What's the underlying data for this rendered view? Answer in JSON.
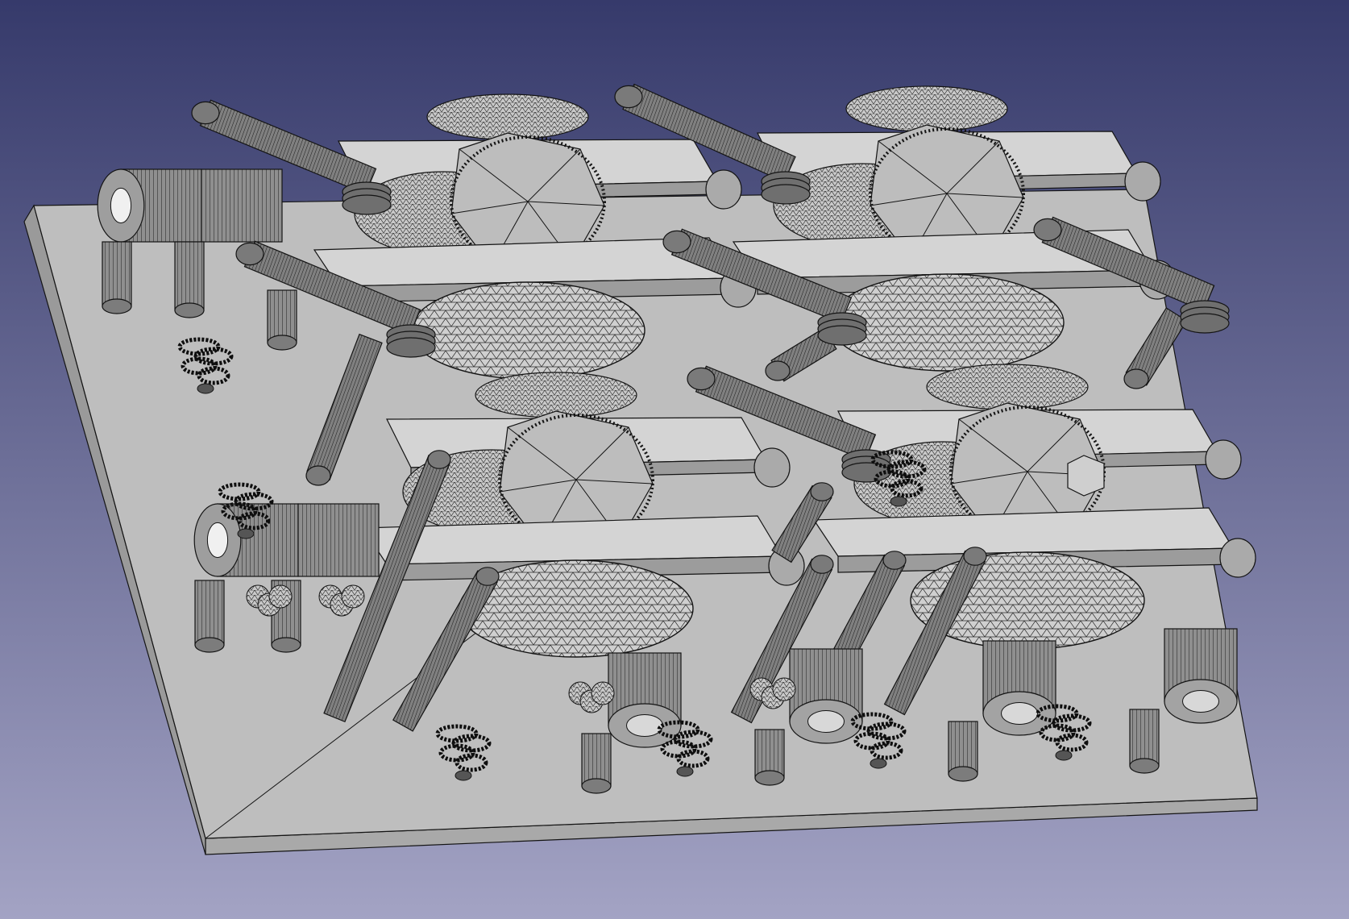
{
  "viewport": {
    "background_top": "#363a6b",
    "background_bottom": "#a3a3c4",
    "mesh_fill": "#bdbdbd",
    "mesh_fill_dark": "#9c9c9c",
    "mesh_fill_light": "#d4d4d4",
    "edge_color": "#141414",
    "cylinder_fill": "#8a8a8a",
    "view_mode": "shaded-wireframe"
  },
  "scene": {
    "object": "base-plate-with-mesh-assemblies",
    "assembly_count": 4,
    "ring_cluster_count": 7
  }
}
